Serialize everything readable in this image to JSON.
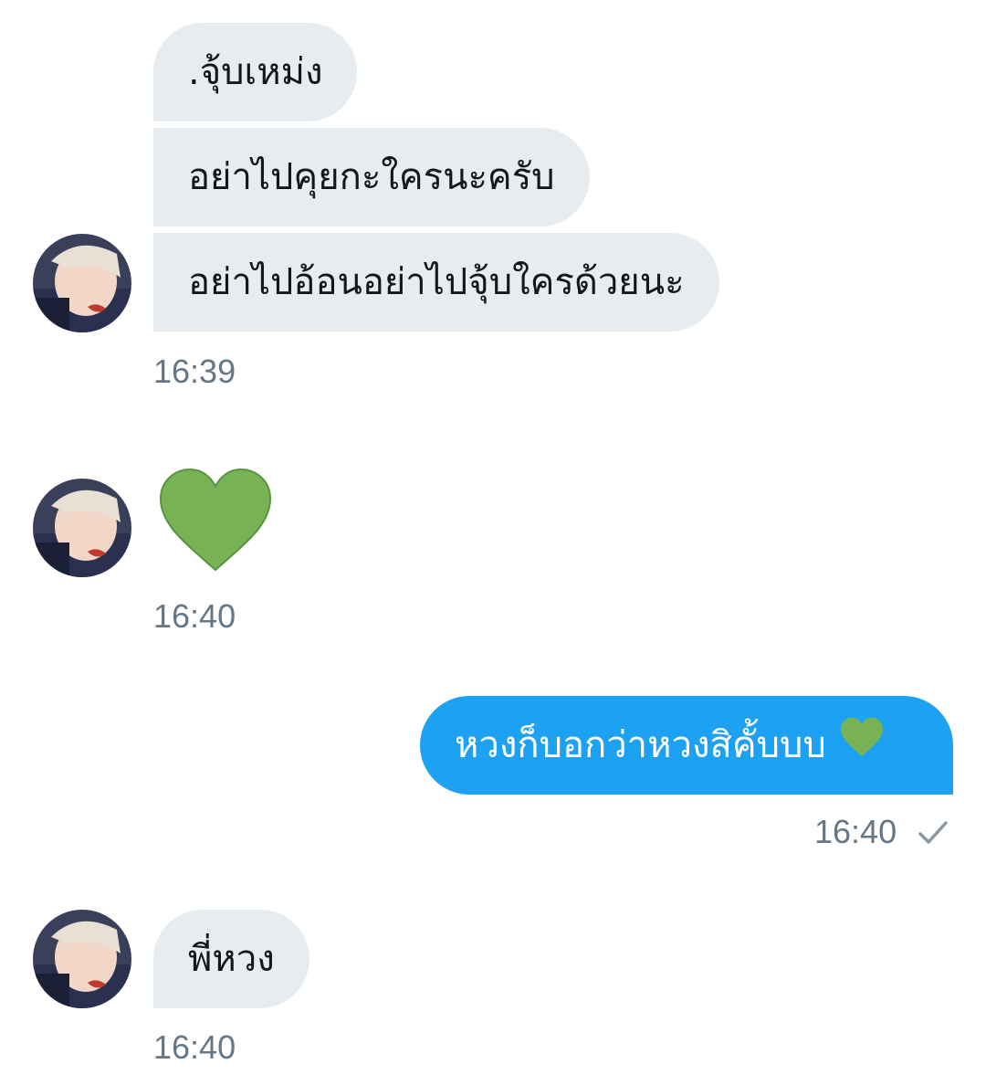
{
  "thread": {
    "group1": {
      "messages": [
        ".จุ้บเหม่ง",
        "อย่าไปคุยกะใครนะครับ",
        "อย่าไปอ้อนอย่าไปจุ้บใครด้วยนะ"
      ],
      "time": "16:39"
    },
    "group2": {
      "emoji": "green-heart-icon",
      "time": "16:40"
    },
    "sent": {
      "text": "หวงก็บอกว่าหวงสิคั้บบบ",
      "emoji": "green-heart-icon",
      "time": "16:40",
      "status": "sent-check-icon"
    },
    "group3": {
      "messages": [
        "พี่หวง"
      ],
      "time": "16:40"
    }
  },
  "colors": {
    "incoming_bubble": "#e6ecf0",
    "outgoing_bubble": "#1da1f2",
    "timestamp": "#657786",
    "heart": "#77b255"
  }
}
